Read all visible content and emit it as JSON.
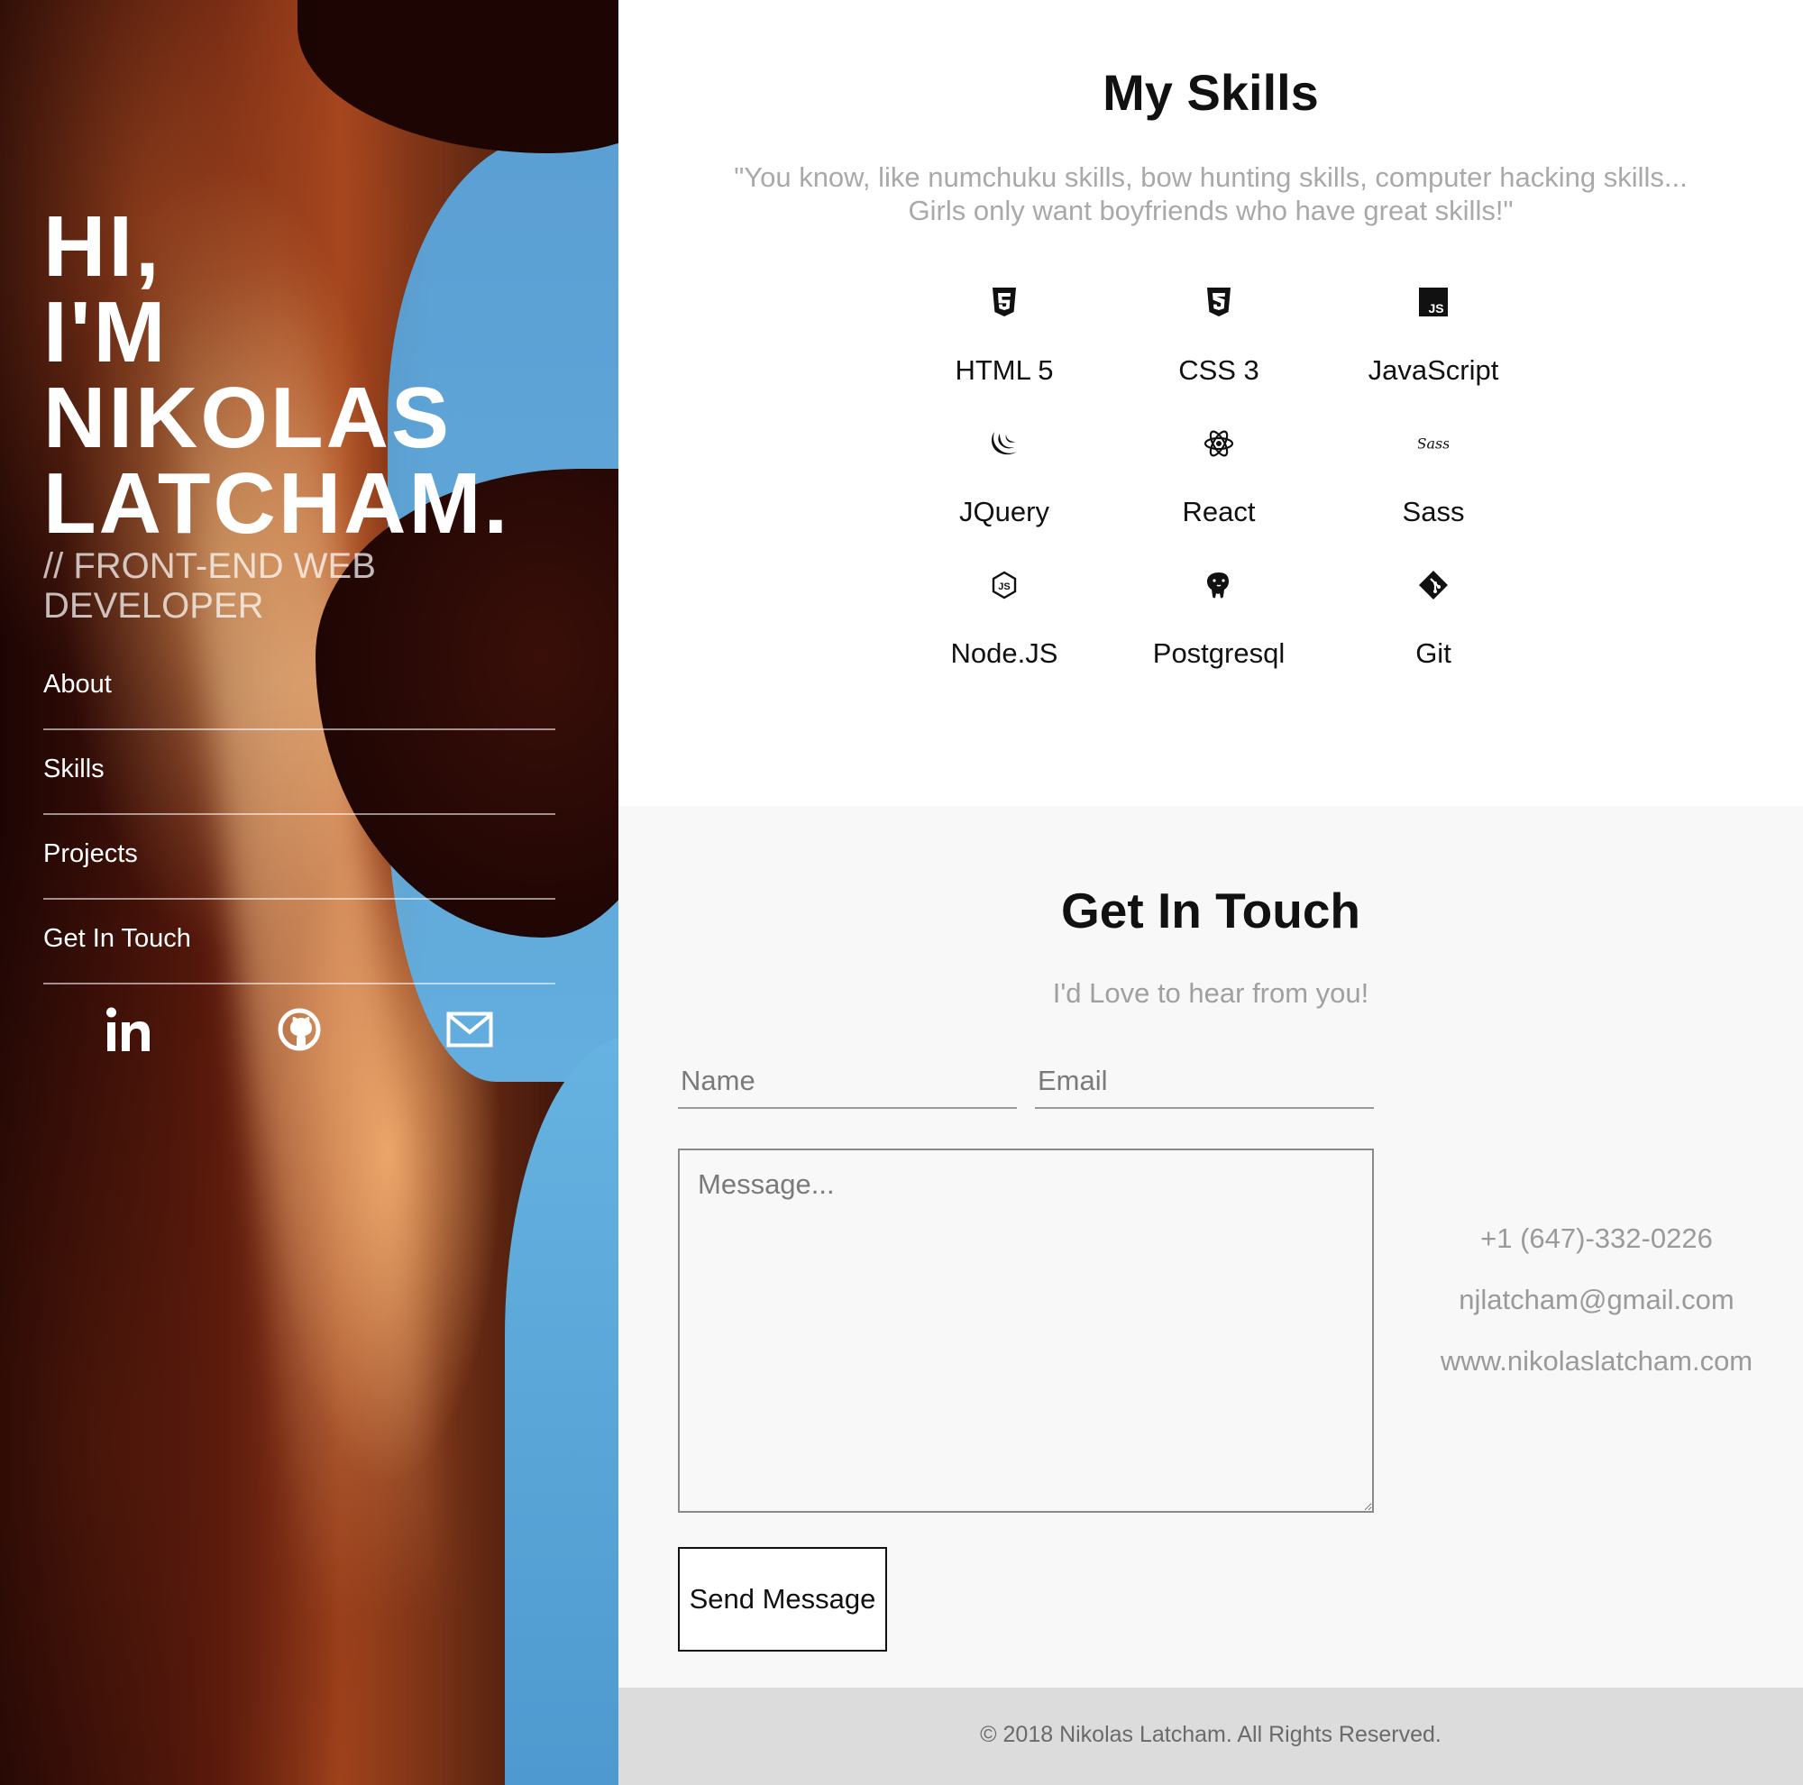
{
  "sidebar": {
    "hero_lines": [
      "HI,",
      "I'M",
      "NIKOLAS",
      "LATCHAM."
    ],
    "subtitle": "// FRONT-END WEB DEVELOPER",
    "nav": [
      {
        "label": "About"
      },
      {
        "label": "Skills"
      },
      {
        "label": "Projects"
      },
      {
        "label": "Get In Touch"
      }
    ],
    "socials": [
      "linkedin-icon",
      "github-icon",
      "mail-icon"
    ]
  },
  "skills": {
    "title": "My Skills",
    "quote_lines": [
      "\"You know, like numchuku skills, bow hunting skills, computer hacking skills...",
      "Girls only want boyfriends who have great skills!\""
    ],
    "items": [
      {
        "label": "HTML 5",
        "icon": "html5-icon"
      },
      {
        "label": "CSS 3",
        "icon": "css3-icon"
      },
      {
        "label": "JavaScript",
        "icon": "javascript-icon"
      },
      {
        "label": "JQuery",
        "icon": "jquery-icon"
      },
      {
        "label": "React",
        "icon": "react-icon"
      },
      {
        "label": "Sass",
        "icon": "sass-icon"
      },
      {
        "label": "Node.JS",
        "icon": "nodejs-icon"
      },
      {
        "label": "Postgresql",
        "icon": "postgresql-icon"
      },
      {
        "label": "Git",
        "icon": "git-icon"
      }
    ]
  },
  "contact": {
    "title": "Get In Touch",
    "subtitle": "I'd Love to hear from you!",
    "name_placeholder": "Name",
    "email_placeholder": "Email",
    "message_placeholder": "Message...",
    "send_label": "Send Message",
    "phone": "+1 (647)-332-0226",
    "email": "njlatcham@gmail.com",
    "website": "www.nikolaslatcham.com"
  },
  "footer": {
    "text": "© 2018 Nikolas Latcham. All Rights Reserved."
  },
  "colors": {
    "accent_text": "#111111",
    "muted_text": "#a9a9a9",
    "contact_bg": "#f8f8f8",
    "footer_bg": "#dcdcdc"
  }
}
